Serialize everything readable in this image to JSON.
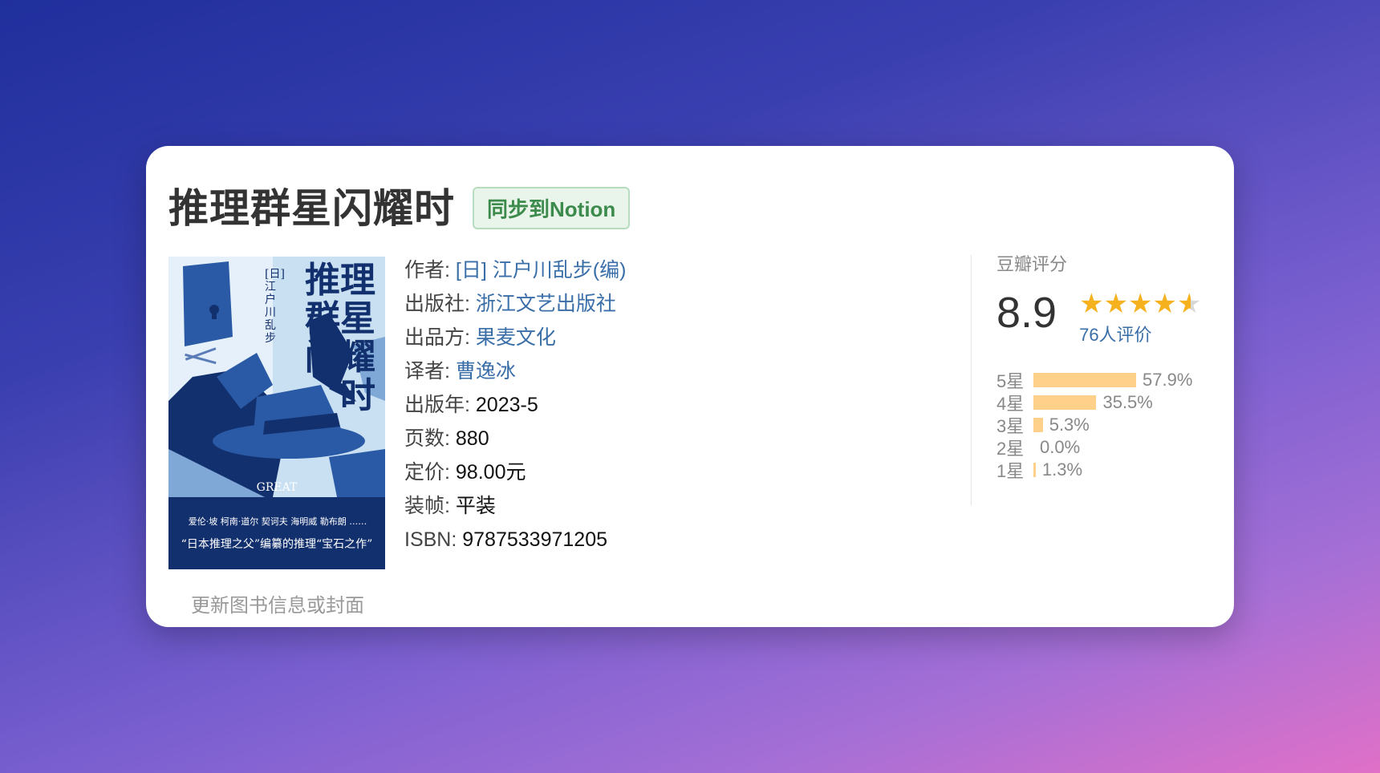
{
  "book": {
    "title": "推理群星闪耀时",
    "sync_button": "同步到Notion",
    "update_link": "更新图书信息或封面"
  },
  "cover": {
    "title_lines": [
      "推理",
      "群星",
      "闪耀",
      "时"
    ],
    "author_line": "[日] 江户川乱步",
    "great": "GREAT",
    "author_list": "爱伦·坡  柯南·道尔  契诃夫  海明威  勒布朗 ……",
    "tagline": "“日本推理之父”编纂的推理“宝石之作”",
    "colors": {
      "dark_navy": "#13306e",
      "mid_blue": "#2a5aa5",
      "light_blue": "#c9e0f3",
      "pale_blue": "#e5f0fa"
    }
  },
  "info": {
    "author": {
      "label": "作者:",
      "value": "[日] 江户川乱步(编)"
    },
    "publisher": {
      "label": "出版社:",
      "value": "浙江文艺出版社"
    },
    "producer": {
      "label": "出品方:",
      "value": "果麦文化"
    },
    "translator": {
      "label": "译者:",
      "value": "曹逸冰"
    },
    "year": {
      "label": "出版年:",
      "value": "2023-5"
    },
    "pages": {
      "label": "页数:",
      "value": "880"
    },
    "price": {
      "label": "定价:",
      "value": "98.00元"
    },
    "binding": {
      "label": "装帧:",
      "value": "平装"
    },
    "isbn": {
      "label": "ISBN:",
      "value": "9787533971205"
    }
  },
  "rating": {
    "label": "豆瓣评分",
    "score": "8.9",
    "stars_value": 4.5,
    "count": "76人评价",
    "distribution": [
      {
        "label": "5星",
        "value": 57.9,
        "pct": "57.9%"
      },
      {
        "label": "4星",
        "value": 35.5,
        "pct": "35.5%"
      },
      {
        "label": "3星",
        "value": 5.3,
        "pct": "5.3%"
      },
      {
        "label": "2星",
        "value": 0.0,
        "pct": "0.0%"
      },
      {
        "label": "1星",
        "value": 1.3,
        "pct": "1.3%"
      }
    ],
    "colors": {
      "star": "#f6b11f",
      "bar": "#ffd08a"
    }
  }
}
